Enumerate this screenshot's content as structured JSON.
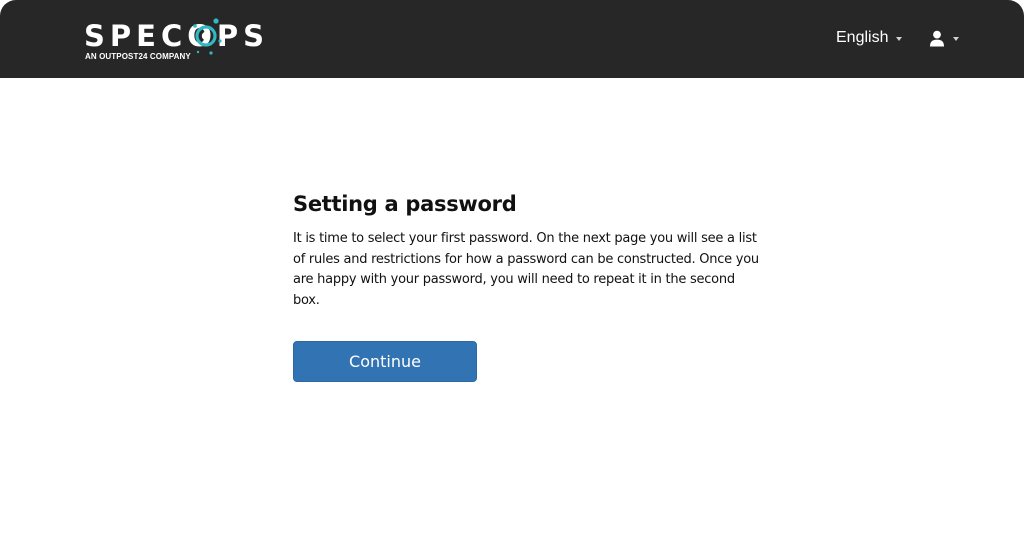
{
  "header": {
    "logo": {
      "wordmark": "SPECOPS",
      "tagline": "AN OUTPOST24 COMPANY",
      "accent_color": "#2fb8c6"
    },
    "language": {
      "selected": "English",
      "icon": "caret-down-icon"
    },
    "user_menu": {
      "icon": "user-icon"
    },
    "background_color": "#272727"
  },
  "main": {
    "title": "Setting a password",
    "description": "It is time to select your first password. On the next page you will see a list of rules and restrictions for how a password can be constructed. Once you are happy with your password, you will need to repeat it in the second box.",
    "continue_label": "Continue",
    "button_color": "#3274b3"
  }
}
